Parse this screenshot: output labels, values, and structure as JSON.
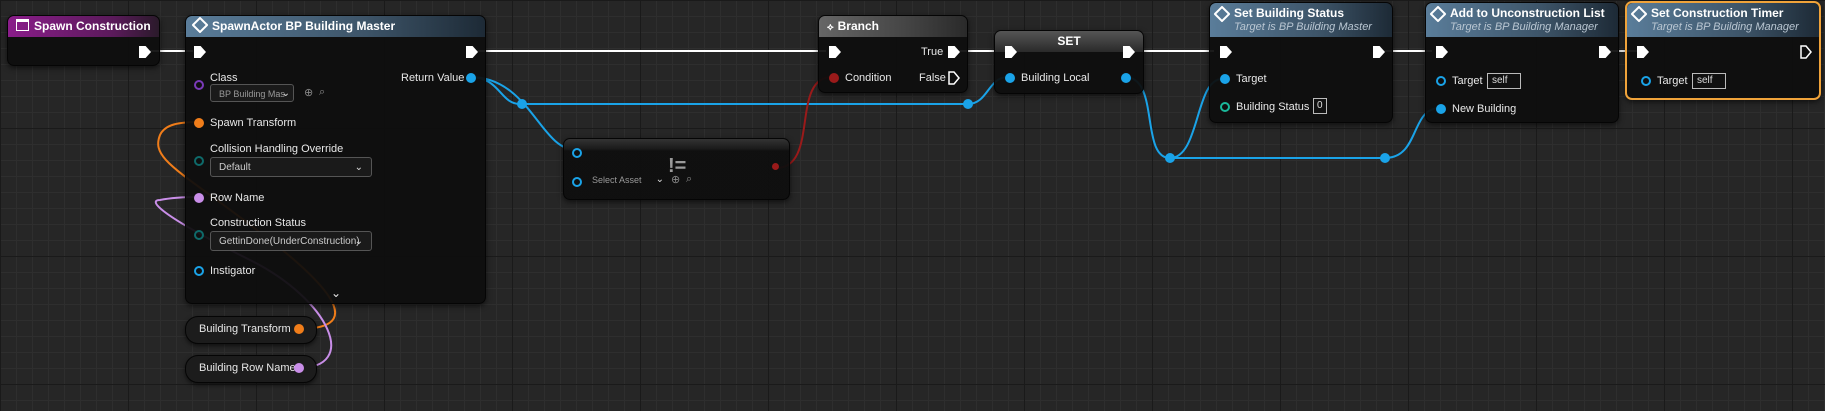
{
  "colors": {
    "exec": "#ffffff",
    "object_pin": "#1aa3e8",
    "transform_pin": "#f07d1a",
    "name_pin": "#c98ee8",
    "bool_pin": "#9a1a1a",
    "enum_pin": "#0e6a6a",
    "function_header": "#5a7d9a",
    "event_header": "#8a1d8a",
    "branch_header": "#555555",
    "selected_outline": "#f0a33a"
  },
  "event_node": {
    "title": "Spawn Construction",
    "icon": "event-icon"
  },
  "spawn_node": {
    "title": "SpawnActor BP Building Master",
    "icon": "function-icon",
    "class_label": "Class",
    "class_value": "BP Building Mas",
    "return_label": "Return Value",
    "spawn_transform_label": "Spawn Transform",
    "collision_label": "Collision Handling Override",
    "collision_value": "Default",
    "row_name_label": "Row Name",
    "construction_status_label": "Construction Status",
    "construction_status_value": "GettinDone(UnderConstruction)",
    "instigator_label": "Instigator",
    "expand_icon": "chevron-down-icon"
  },
  "not_equal_node": {
    "symbol": "!=",
    "select_value": "Select Asset"
  },
  "branch_node": {
    "title": "Branch",
    "icon": "branch-icon",
    "true_label": "True",
    "condition_label": "Condition",
    "false_label": "False"
  },
  "set_node": {
    "title": "SET",
    "var_label": "Building Local"
  },
  "set_status_node": {
    "title": "Set Building Status",
    "subtitle": "Target is BP Building Master",
    "target_label": "Target",
    "status_label": "Building Status",
    "status_value": "0"
  },
  "add_list_node": {
    "title": "Add to Unconstruction List",
    "subtitle": "Target is BP Building Manager",
    "target_label": "Target",
    "target_value": "self",
    "new_building_label": "New Building"
  },
  "timer_node": {
    "title": "Set Construction Timer",
    "subtitle": "Target is BP Building Manager",
    "target_label": "Target",
    "target_value": "self"
  },
  "var_transform": {
    "label": "Building Transform"
  },
  "var_row_name": {
    "label": "Building Row Name"
  }
}
